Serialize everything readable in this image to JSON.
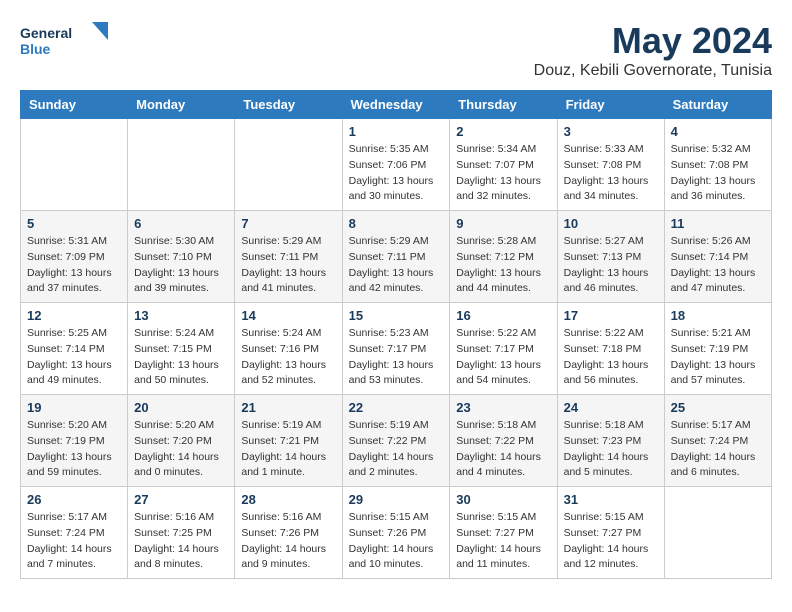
{
  "logo": {
    "line1": "General",
    "line2": "Blue"
  },
  "title": "May 2024",
  "subtitle": "Douz, Kebili Governorate, Tunisia",
  "days_of_week": [
    "Sunday",
    "Monday",
    "Tuesday",
    "Wednesday",
    "Thursday",
    "Friday",
    "Saturday"
  ],
  "weeks": [
    [
      {
        "day": "",
        "info": ""
      },
      {
        "day": "",
        "info": ""
      },
      {
        "day": "",
        "info": ""
      },
      {
        "day": "1",
        "info": "Sunrise: 5:35 AM\nSunset: 7:06 PM\nDaylight: 13 hours\nand 30 minutes."
      },
      {
        "day": "2",
        "info": "Sunrise: 5:34 AM\nSunset: 7:07 PM\nDaylight: 13 hours\nand 32 minutes."
      },
      {
        "day": "3",
        "info": "Sunrise: 5:33 AM\nSunset: 7:08 PM\nDaylight: 13 hours\nand 34 minutes."
      },
      {
        "day": "4",
        "info": "Sunrise: 5:32 AM\nSunset: 7:08 PM\nDaylight: 13 hours\nand 36 minutes."
      }
    ],
    [
      {
        "day": "5",
        "info": "Sunrise: 5:31 AM\nSunset: 7:09 PM\nDaylight: 13 hours\nand 37 minutes."
      },
      {
        "day": "6",
        "info": "Sunrise: 5:30 AM\nSunset: 7:10 PM\nDaylight: 13 hours\nand 39 minutes."
      },
      {
        "day": "7",
        "info": "Sunrise: 5:29 AM\nSunset: 7:11 PM\nDaylight: 13 hours\nand 41 minutes."
      },
      {
        "day": "8",
        "info": "Sunrise: 5:29 AM\nSunset: 7:11 PM\nDaylight: 13 hours\nand 42 minutes."
      },
      {
        "day": "9",
        "info": "Sunrise: 5:28 AM\nSunset: 7:12 PM\nDaylight: 13 hours\nand 44 minutes."
      },
      {
        "day": "10",
        "info": "Sunrise: 5:27 AM\nSunset: 7:13 PM\nDaylight: 13 hours\nand 46 minutes."
      },
      {
        "day": "11",
        "info": "Sunrise: 5:26 AM\nSunset: 7:14 PM\nDaylight: 13 hours\nand 47 minutes."
      }
    ],
    [
      {
        "day": "12",
        "info": "Sunrise: 5:25 AM\nSunset: 7:14 PM\nDaylight: 13 hours\nand 49 minutes."
      },
      {
        "day": "13",
        "info": "Sunrise: 5:24 AM\nSunset: 7:15 PM\nDaylight: 13 hours\nand 50 minutes."
      },
      {
        "day": "14",
        "info": "Sunrise: 5:24 AM\nSunset: 7:16 PM\nDaylight: 13 hours\nand 52 minutes."
      },
      {
        "day": "15",
        "info": "Sunrise: 5:23 AM\nSunset: 7:17 PM\nDaylight: 13 hours\nand 53 minutes."
      },
      {
        "day": "16",
        "info": "Sunrise: 5:22 AM\nSunset: 7:17 PM\nDaylight: 13 hours\nand 54 minutes."
      },
      {
        "day": "17",
        "info": "Sunrise: 5:22 AM\nSunset: 7:18 PM\nDaylight: 13 hours\nand 56 minutes."
      },
      {
        "day": "18",
        "info": "Sunrise: 5:21 AM\nSunset: 7:19 PM\nDaylight: 13 hours\nand 57 minutes."
      }
    ],
    [
      {
        "day": "19",
        "info": "Sunrise: 5:20 AM\nSunset: 7:19 PM\nDaylight: 13 hours\nand 59 minutes."
      },
      {
        "day": "20",
        "info": "Sunrise: 5:20 AM\nSunset: 7:20 PM\nDaylight: 14 hours\nand 0 minutes."
      },
      {
        "day": "21",
        "info": "Sunrise: 5:19 AM\nSunset: 7:21 PM\nDaylight: 14 hours\nand 1 minute."
      },
      {
        "day": "22",
        "info": "Sunrise: 5:19 AM\nSunset: 7:22 PM\nDaylight: 14 hours\nand 2 minutes."
      },
      {
        "day": "23",
        "info": "Sunrise: 5:18 AM\nSunset: 7:22 PM\nDaylight: 14 hours\nand 4 minutes."
      },
      {
        "day": "24",
        "info": "Sunrise: 5:18 AM\nSunset: 7:23 PM\nDaylight: 14 hours\nand 5 minutes."
      },
      {
        "day": "25",
        "info": "Sunrise: 5:17 AM\nSunset: 7:24 PM\nDaylight: 14 hours\nand 6 minutes."
      }
    ],
    [
      {
        "day": "26",
        "info": "Sunrise: 5:17 AM\nSunset: 7:24 PM\nDaylight: 14 hours\nand 7 minutes."
      },
      {
        "day": "27",
        "info": "Sunrise: 5:16 AM\nSunset: 7:25 PM\nDaylight: 14 hours\nand 8 minutes."
      },
      {
        "day": "28",
        "info": "Sunrise: 5:16 AM\nSunset: 7:26 PM\nDaylight: 14 hours\nand 9 minutes."
      },
      {
        "day": "29",
        "info": "Sunrise: 5:15 AM\nSunset: 7:26 PM\nDaylight: 14 hours\nand 10 minutes."
      },
      {
        "day": "30",
        "info": "Sunrise: 5:15 AM\nSunset: 7:27 PM\nDaylight: 14 hours\nand 11 minutes."
      },
      {
        "day": "31",
        "info": "Sunrise: 5:15 AM\nSunset: 7:27 PM\nDaylight: 14 hours\nand 12 minutes."
      },
      {
        "day": "",
        "info": ""
      }
    ]
  ]
}
